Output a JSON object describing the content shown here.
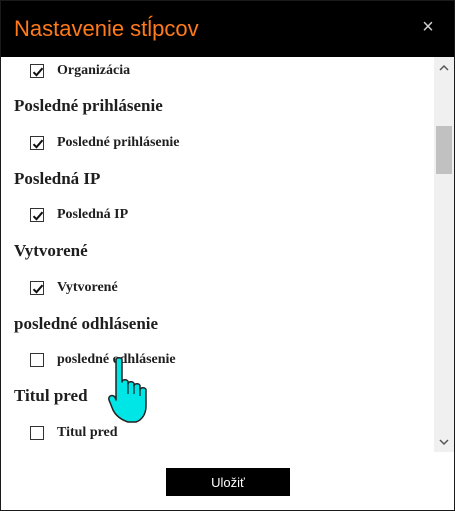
{
  "dialog": {
    "title": "Nastavenie stĺpcov",
    "close_icon": "×",
    "save_label": "Uložiť"
  },
  "groups": [
    {
      "header": "",
      "item": {
        "label": "Organizácia",
        "checked": true
      }
    },
    {
      "header": "Posledné prihlásenie",
      "item": {
        "label": "Posledné prihlásenie",
        "checked": true
      }
    },
    {
      "header": "Posledná IP",
      "item": {
        "label": "Posledná IP",
        "checked": true
      }
    },
    {
      "header": "Vytvorené",
      "item": {
        "label": "Vytvorené",
        "checked": true
      }
    },
    {
      "header": "posledné odhlásenie",
      "item": {
        "label": "posledné odhlásenie",
        "checked": false
      }
    },
    {
      "header": "Titul pred",
      "item": {
        "label": "Titul pred",
        "checked": false
      }
    }
  ],
  "scrollbar": {
    "up_icon": "chevron-up-icon",
    "down_icon": "chevron-down-icon"
  },
  "colors": {
    "titlebar_bg": "#000000",
    "title_text": "#ff7a1a",
    "button_bg": "#000000",
    "cursor_fill": "#00e5e5"
  }
}
